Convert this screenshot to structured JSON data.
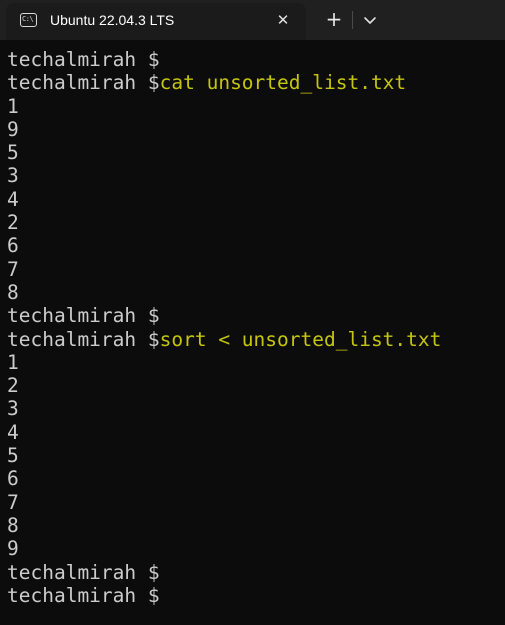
{
  "window": {
    "tab_title": "Ubuntu 22.04.3 LTS",
    "tab_icon": "terminal-icon",
    "close_icon": "close-icon",
    "new_tab_icon": "plus-icon",
    "dropdown_icon": "chevron-down-icon"
  },
  "colors": {
    "background": "#0c0c0c",
    "titlebar": "#202020",
    "text": "#cccccc",
    "command": "#c5c50f"
  },
  "terminal": {
    "prompt": "techalmirah $",
    "lines": [
      {
        "type": "prompt",
        "prompt": "techalmirah $",
        "command": ""
      },
      {
        "type": "prompt",
        "prompt": "techalmirah $",
        "command": "cat unsorted_list.txt"
      },
      {
        "type": "output",
        "text": "1"
      },
      {
        "type": "output",
        "text": "9"
      },
      {
        "type": "output",
        "text": "5"
      },
      {
        "type": "output",
        "text": "3"
      },
      {
        "type": "output",
        "text": "4"
      },
      {
        "type": "output",
        "text": "2"
      },
      {
        "type": "output",
        "text": "6"
      },
      {
        "type": "output",
        "text": "7"
      },
      {
        "type": "output",
        "text": "8"
      },
      {
        "type": "prompt",
        "prompt": "techalmirah $",
        "command": ""
      },
      {
        "type": "prompt",
        "prompt": "techalmirah $",
        "command": "sort < unsorted_list.txt"
      },
      {
        "type": "output",
        "text": "1"
      },
      {
        "type": "output",
        "text": "2"
      },
      {
        "type": "output",
        "text": "3"
      },
      {
        "type": "output",
        "text": "4"
      },
      {
        "type": "output",
        "text": "5"
      },
      {
        "type": "output",
        "text": "6"
      },
      {
        "type": "output",
        "text": "7"
      },
      {
        "type": "output",
        "text": "8"
      },
      {
        "type": "output",
        "text": "9"
      },
      {
        "type": "prompt",
        "prompt": "techalmirah $",
        "command": ""
      },
      {
        "type": "prompt",
        "prompt": "techalmirah $",
        "command": ""
      }
    ]
  }
}
